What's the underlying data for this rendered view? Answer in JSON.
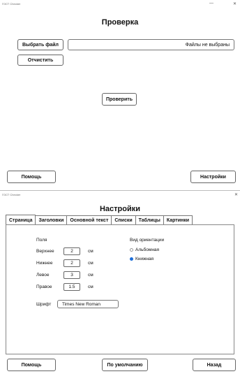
{
  "window1": {
    "app_title": "ГОСТ Checker",
    "close_glyph": "✕",
    "min_glyph": "—",
    "heading": "Проверка",
    "choose_file_button": "Выбрать файл",
    "file_field_value": "Файлы не выбраны",
    "clear_button": "Отчистить",
    "check_button": "Проверить",
    "help_button": "Помощь",
    "settings_button": "Настройки"
  },
  "window2": {
    "app_title": "ГОСТ Checker",
    "close_glyph": "✕",
    "heading": "Настройки",
    "tabs": [
      "Страница",
      "Заголовки",
      "Основной текст",
      "Списки",
      "Таблицы",
      "Картинки"
    ],
    "active_tab": 0,
    "margins": {
      "title": "Поля",
      "top_label": "Верхнее",
      "top_value": "2",
      "bottom_label": "Нижнее",
      "bottom_value": "2",
      "left_label": "Левое",
      "left_value": "3",
      "right_label": "Правое",
      "right_value": "1.5",
      "unit": "см"
    },
    "font": {
      "label": "Шрифт",
      "value": "Times New Roman"
    },
    "orientation": {
      "title": "Вид ориентации",
      "options": [
        "Альбомная",
        "Книжная"
      ],
      "selected": "Книжная"
    },
    "help_button": "Помощь",
    "defaults_button": "По умолчанию",
    "back_button": "Назад"
  },
  "colors": {
    "radio_selected": "#1e6fd9",
    "border": "#666666"
  }
}
